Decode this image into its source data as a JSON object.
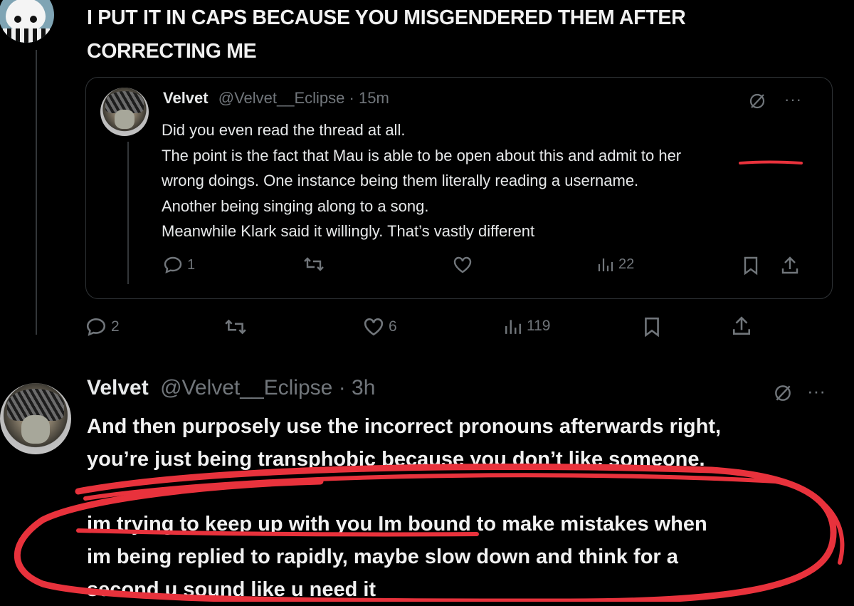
{
  "outer_post": {
    "text_lines": [
      "I PUT IT IN CAPS BECAUSE YOU MISGENDERED THEM AFTER",
      "CORRECTING ME"
    ],
    "actions": {
      "replies": "2",
      "reposts": "",
      "likes": "6",
      "views": "119"
    }
  },
  "quoted_post": {
    "name": "Velvet",
    "handle": "@Velvet__Eclipse",
    "dot": "·",
    "time": "15m",
    "more": "···",
    "lines": [
      "Did you even read the thread at all.",
      "The point is the fact that Mau is able to be open about this and admit to her",
      "wrong doings. One instance being them literally reading a username.",
      "Another being singing along to a song.",
      "Meanwhile Klark said it willingly. That’s vastly different"
    ],
    "actions": {
      "replies": "1",
      "reposts": "",
      "likes": "",
      "views": "22"
    }
  },
  "reply_post": {
    "name": "Velvet",
    "handle": "@Velvet__Eclipse",
    "dot": "·",
    "time": "3h",
    "more": "···",
    "lines": [
      "And then purposely use the incorrect pronouns afterwards right,",
      "you’re just being transphobic because you don’t like someone."
    ],
    "quoted_reply_lines": [
      "im trying to keep up with you Im bound to make mistakes when",
      "im being replied to rapidly, maybe slow down and think for a",
      "second u sound like u need it"
    ]
  },
  "colors": {
    "background": "#000000",
    "text": "#e7e9ea",
    "muted": "#71767b",
    "border": "#2f3336",
    "annotation_red": "#e8323c"
  },
  "icons": [
    "reply-icon",
    "repost-icon",
    "like-icon",
    "views-icon",
    "bookmark-icon",
    "share-icon",
    "grok-icon",
    "more-icon"
  ]
}
